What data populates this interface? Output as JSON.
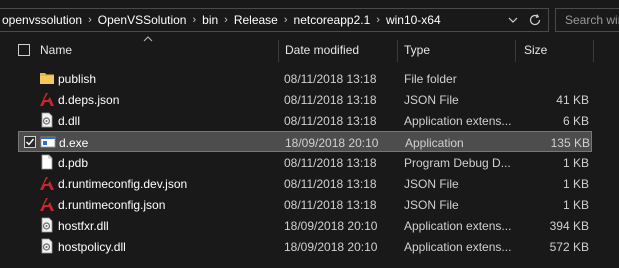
{
  "address": {
    "crumbs": [
      "openvssolution",
      "OpenVSSolution",
      "bin",
      "Release",
      "netcoreapp2.1",
      "win10-x64"
    ],
    "search_placeholder": "Search win"
  },
  "columns": {
    "name": "Name",
    "date": "Date modified",
    "type": "Type",
    "size": "Size"
  },
  "files": [
    {
      "name": "publish",
      "date": "08/11/2018 13:18",
      "type": "File folder",
      "size": "",
      "icon": "folder-icon",
      "selected": false
    },
    {
      "name": "d.deps.json",
      "date": "08/11/2018 13:18",
      "type": "JSON File",
      "size": "41 KB",
      "icon": "json-file-icon",
      "selected": false
    },
    {
      "name": "d.dll",
      "date": "08/11/2018 13:18",
      "type": "Application extens...",
      "size": "6 KB",
      "icon": "dll-file-icon",
      "selected": false
    },
    {
      "name": "d.exe",
      "date": "18/09/2018 20:10",
      "type": "Application",
      "size": "135 KB",
      "icon": "exe-file-icon",
      "selected": true
    },
    {
      "name": "d.pdb",
      "date": "08/11/2018 13:18",
      "type": "Program Debug D...",
      "size": "1 KB",
      "icon": "blank-file-icon",
      "selected": false
    },
    {
      "name": "d.runtimeconfig.dev.json",
      "date": "08/11/2018 13:18",
      "type": "JSON File",
      "size": "1 KB",
      "icon": "json-file-icon",
      "selected": false
    },
    {
      "name": "d.runtimeconfig.json",
      "date": "08/11/2018 13:18",
      "type": "JSON File",
      "size": "1 KB",
      "icon": "json-file-icon",
      "selected": false
    },
    {
      "name": "hostfxr.dll",
      "date": "18/09/2018 20:10",
      "type": "Application extens...",
      "size": "394 KB",
      "icon": "dll-file-icon",
      "selected": false
    },
    {
      "name": "hostpolicy.dll",
      "date": "18/09/2018 20:10",
      "type": "Application extens...",
      "size": "572 KB",
      "icon": "dll-file-icon",
      "selected": false
    }
  ],
  "colors": {
    "background": "#191919",
    "selection": "#4d4d4d",
    "folder": "#e8b84a",
    "json_red": "#c8262c"
  }
}
